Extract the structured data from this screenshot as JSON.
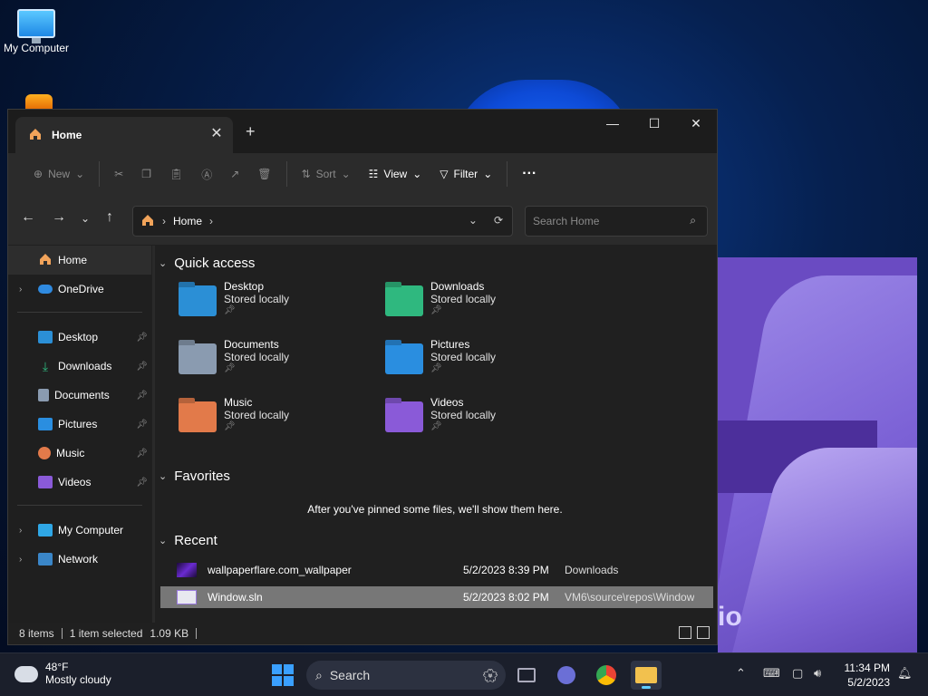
{
  "desktop": {
    "icons": [
      {
        "label": "My Computer"
      }
    ],
    "bg_text": "io"
  },
  "window": {
    "tab_title": "Home",
    "toolbar": {
      "new_label": "New",
      "sort_label": "Sort",
      "view_label": "View",
      "filter_label": "Filter"
    },
    "address": {
      "crumbs": [
        "Home"
      ]
    },
    "search_placeholder": "Search Home",
    "sidebar": {
      "top": [
        {
          "label": "Home",
          "selected": true,
          "icon": "home-icon"
        },
        {
          "label": "OneDrive",
          "expandable": true,
          "icon": "cloud-icon"
        }
      ],
      "pinned": [
        {
          "label": "Desktop",
          "icon": "desktop-folder-icon"
        },
        {
          "label": "Downloads",
          "icon": "download-icon"
        },
        {
          "label": "Documents",
          "icon": "documents-icon"
        },
        {
          "label": "Pictures",
          "icon": "pictures-icon"
        },
        {
          "label": "Music",
          "icon": "music-icon"
        },
        {
          "label": "Videos",
          "icon": "videos-icon"
        }
      ],
      "bottom": [
        {
          "label": "My Computer",
          "icon": "computer-icon"
        },
        {
          "label": "Network",
          "icon": "network-icon"
        }
      ]
    },
    "quick_access": {
      "title": "Quick access",
      "items": [
        {
          "name": "Desktop",
          "sub": "Stored locally",
          "color": "#2b8fd6"
        },
        {
          "name": "Downloads",
          "sub": "Stored locally",
          "color": "#2fb87f"
        },
        {
          "name": "Documents",
          "sub": "Stored locally",
          "color": "#8a9bb0"
        },
        {
          "name": "Pictures",
          "sub": "Stored locally",
          "color": "#2a8ee0"
        },
        {
          "name": "Music",
          "sub": "Stored locally",
          "color": "#e27a4a"
        },
        {
          "name": "Videos",
          "sub": "Stored locally",
          "color": "#8a5ad8"
        }
      ]
    },
    "favorites": {
      "title": "Favorites",
      "empty_text": "After you've pinned some files, we'll show them here."
    },
    "recent": {
      "title": "Recent",
      "rows": [
        {
          "name": "wallpaperflare.com_wallpaper",
          "date": "5/2/2023 8:39 PM",
          "location": "Downloads",
          "selected": false
        },
        {
          "name": "Window.sln",
          "date": "5/2/2023 8:02 PM",
          "location": "VM6\\source\\repos\\Window",
          "selected": true
        }
      ]
    },
    "status": {
      "items": "8 items",
      "selected": "1 item selected",
      "size": "1.09 KB"
    }
  },
  "taskbar": {
    "weather_temp": "48°F",
    "weather_desc": "Mostly cloudy",
    "search_label": "Search",
    "time": "11:34 PM",
    "date": "5/2/2023"
  },
  "colors": {
    "accent": "#60cdff",
    "window_bg": "#202020",
    "toolbar_bg": "#2b2b2b",
    "selected_row": "#777777"
  }
}
